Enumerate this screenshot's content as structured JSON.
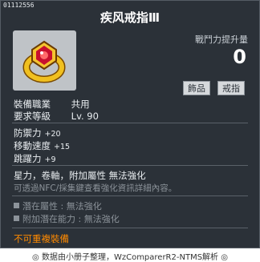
{
  "item_id": "01112556",
  "title": "疾风戒指Ⅲ",
  "combat_power": {
    "label": "戰鬥力提升量",
    "value": "0"
  },
  "tags": [
    "飾品",
    "戒指"
  ],
  "job": {
    "label": "裝備職業",
    "value": "共用"
  },
  "req_level": {
    "label": "要求等級",
    "value": "Lv. 90"
  },
  "stats": [
    {
      "label": "防禦力",
      "value": "+20"
    },
    {
      "label": "移動速度",
      "value": "+15"
    },
    {
      "label": "跳躍力",
      "value": "+9"
    }
  ],
  "desc_line1": "星力，卷軸，附加屬性 無法強化",
  "desc_line2": "可透過NFC/採集鍵查看強化資訊詳細內容。",
  "potential": {
    "label": "潛在屬性",
    "value": "無法強化"
  },
  "bonus_potential": {
    "label": "附加潛在能力",
    "value": "無法強化"
  },
  "unique_note": "不可重複裝備",
  "footer": "◎ 数据由小册子整理，WzComparerR2-NTMS解析 ◎",
  "icon_name": "ring-icon"
}
